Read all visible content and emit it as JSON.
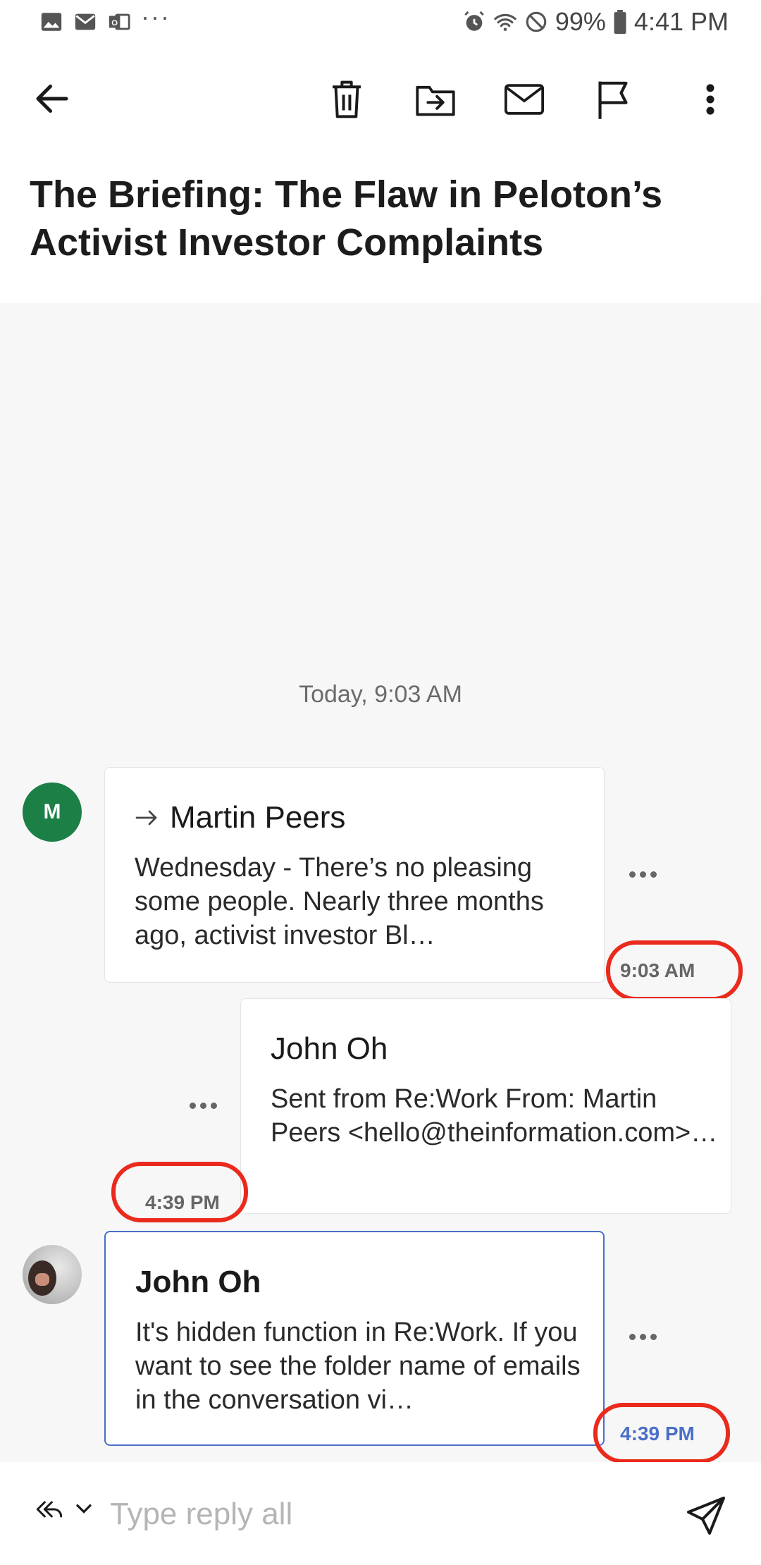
{
  "status_bar": {
    "left_icons": [
      "gallery-icon",
      "email-icon",
      "outlook-icon"
    ],
    "more": "···",
    "battery": "99%",
    "time": "4:41 PM"
  },
  "toolbar": {
    "back": "back-arrow-icon",
    "actions": [
      "trash-icon",
      "move-to-folder-icon",
      "mail-icon",
      "flag-icon",
      "more-vertical-icon"
    ]
  },
  "subject": "The Briefing: The Flaw in Peloton’s Activist Investor Complaints",
  "date_divider": "Today, 9:03 AM",
  "messages": [
    {
      "avatar_initial": "M",
      "sender": "Martin Peers",
      "preview": "Wednesday - There’s no pleasing some people. Nearly three months ago, activist investor Bl…",
      "time": "9:03 AM",
      "forwarded": true
    },
    {
      "sender": "John Oh",
      "preview": "Sent from Re:Work From: Martin Peers <hello@theinformation.com>…",
      "time": "4:39 PM"
    },
    {
      "sender": "John Oh",
      "preview": "It's hidden function in Re:Work. If you want to see the folder name of emails in the conversation vi…",
      "time": "4:39 PM",
      "selected": true
    }
  ],
  "reply": {
    "placeholder": "Type reply all"
  },
  "colors": {
    "accent": "#4a6fc9",
    "avatar_green": "#1b7f46",
    "highlight_ring": "#ea2a1c"
  }
}
